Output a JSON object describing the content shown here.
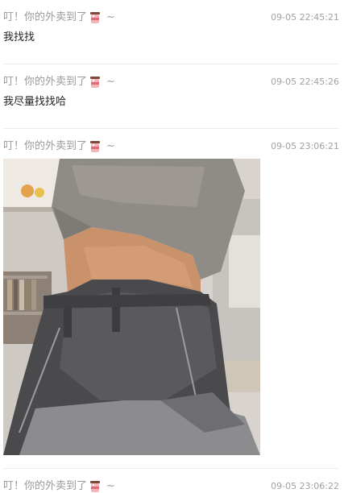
{
  "messages": [
    {
      "sender": "叮！你的外卖到了",
      "suffix": "~",
      "time": "09-05 22:45:21",
      "text": "我找找"
    },
    {
      "sender": "叮！你的外卖到了",
      "suffix": "~",
      "time": "09-05 22:45:26",
      "text": "我尽量找找哈"
    },
    {
      "sender": "叮！你的外卖到了",
      "suffix": "~",
      "time": "09-05 23:06:21"
    },
    {
      "sender": "叮！你的外卖到了",
      "suffix": "~",
      "time": "09-05 23:06:22"
    }
  ],
  "icons": {
    "sender_emoji": "bubble-tea-cup-icon"
  },
  "colors": {
    "sender": "#9a9a9a",
    "time": "#a0a0a0",
    "text": "#222222",
    "divider": "#ececec"
  }
}
